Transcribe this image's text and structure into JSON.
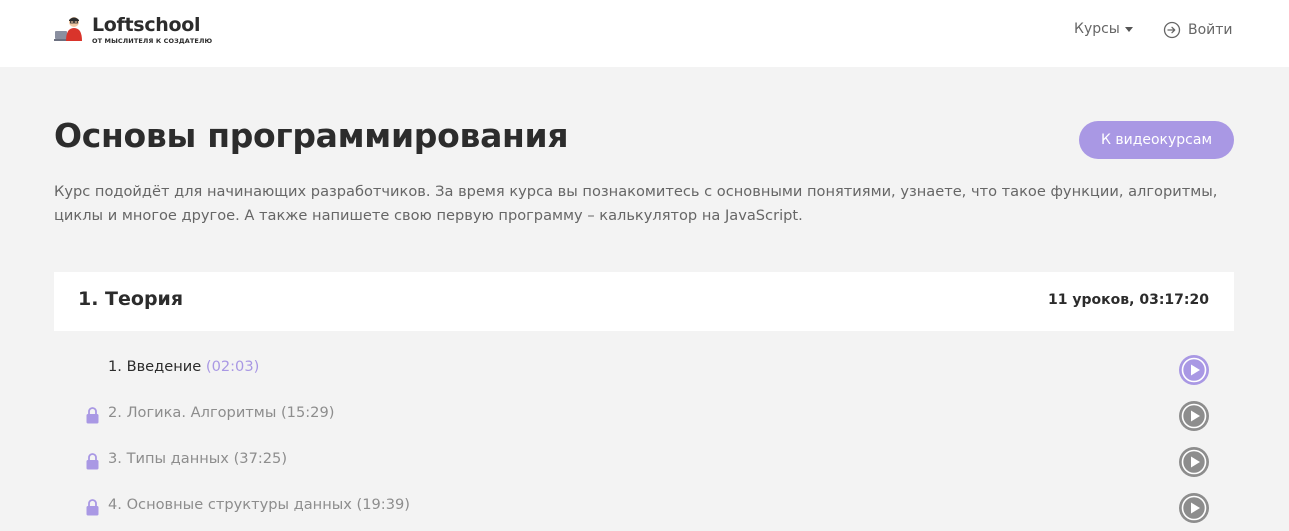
{
  "header": {
    "logo_name": "Loftschool",
    "logo_tagline": "ОТ МЫСЛИТЕЛЯ К СОЗДАТЕЛЮ",
    "nav_courses": "Курсы",
    "nav_login": "Войти"
  },
  "course": {
    "title": "Основы программирования",
    "video_button": "К видеокурсам",
    "description": "Курс подойдёт для начинающих разработчиков. За время курса вы познакомитесь с основными понятиями, узнаете, что такое функции, алгоритмы, циклы и многое другое. А также напишете свою первую программу – калькулятор на JavaScript."
  },
  "section": {
    "title": "1. Теория",
    "meta": "11 уроков, 03:17:20"
  },
  "lessons": [
    {
      "title": "1. Введение",
      "duration": "(02:03)",
      "locked": false
    },
    {
      "title": "2. Логика. Алгоритмы",
      "duration": "(15:29)",
      "locked": true
    },
    {
      "title": "3. Типы данных",
      "duration": "(37:25)",
      "locked": true
    },
    {
      "title": "4. Основные структуры данных",
      "duration": "(19:39)",
      "locked": true
    }
  ],
  "colors": {
    "accent": "#a998e4",
    "play_inactive": "#8d8d8d",
    "background": "#f3f3f3"
  },
  "icons": [
    "logo-mark-icon",
    "caret-down-icon",
    "login-icon",
    "lock-icon",
    "play-icon"
  ]
}
